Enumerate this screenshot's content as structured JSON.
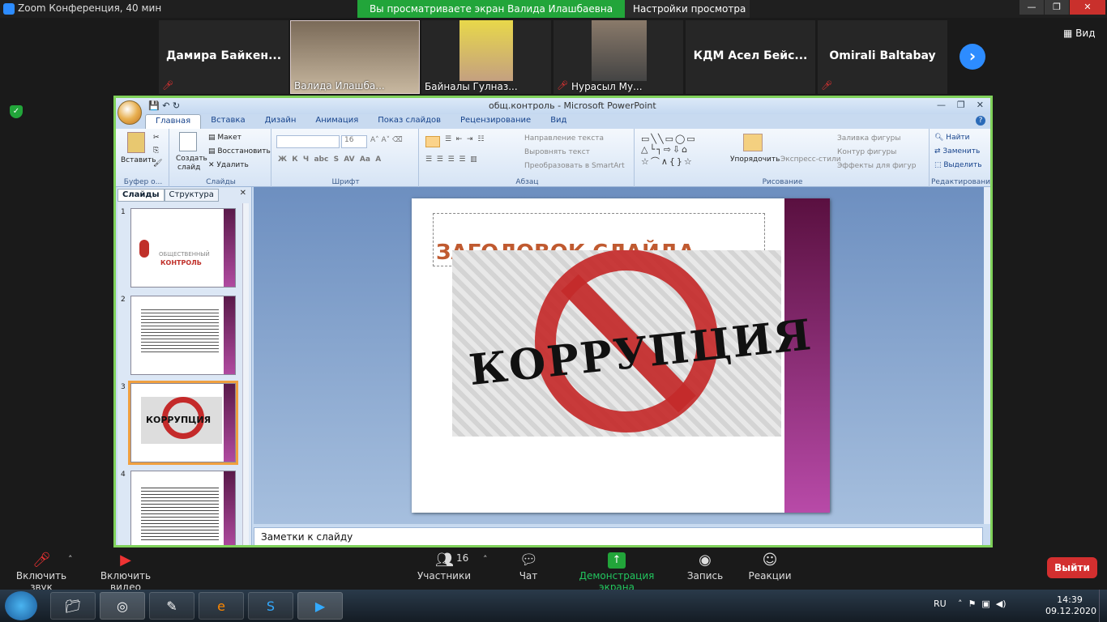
{
  "zoom": {
    "window_title": "Zoom Конференция, 40 мин",
    "share_banner": "Вы просматриваете экран Валида Илашбаевна",
    "view_options": "Настройки просмотра",
    "view_label": "Вид",
    "participants": [
      {
        "name": "Дамира  Байкен...",
        "muted": true,
        "video": false
      },
      {
        "name": "Валида Илашба...",
        "muted": false,
        "video": true
      },
      {
        "name": "Байналы Гулназ...",
        "muted": false,
        "video": true
      },
      {
        "name": "Нурасыл Му...",
        "muted": true,
        "video": true
      },
      {
        "name": "КДМ  Асел  Бейс...",
        "muted": false,
        "video": false
      },
      {
        "name": "Omirali Baltabay",
        "muted": true,
        "video": false
      }
    ],
    "toolbar": {
      "audio": "Включить звук",
      "video": "Включить видео",
      "participants": "Участники",
      "participants_count": "16",
      "chat": "Чат",
      "share": "Демонстрация экрана",
      "record": "Запись",
      "reactions": "Реакции",
      "leave": "Выйти"
    }
  },
  "ppt": {
    "title": "общ.контроль - Microsoft PowerPoint",
    "tabs": [
      "Главная",
      "Вставка",
      "Дизайн",
      "Анимация",
      "Показ слайдов",
      "Рецензирование",
      "Вид"
    ],
    "groups": {
      "clipboard": {
        "label": "Буфер о...",
        "paste": "Вставить"
      },
      "slides": {
        "label": "Слайды",
        "new_slide": "Создать",
        "new_slide2": "слайд",
        "layout": "Макет",
        "reset": "Восстановить",
        "delete": "Удалить"
      },
      "font": {
        "label": "Шрифт",
        "size": "16"
      },
      "paragraph": {
        "label": "Абзац",
        "text_dir": "Направление текста",
        "align": "Выровнять текст",
        "smartart": "Преобразовать в SmartArt"
      },
      "drawing": {
        "label": "Рисование",
        "arrange": "Упорядочить",
        "styles": "Экспресс-стили",
        "fill": "Заливка фигуры",
        "outline": "Контур фигуры",
        "effects": "Эффекты для фигур"
      },
      "editing": {
        "label": "Редактирование",
        "find": "Найти",
        "replace": "Заменить",
        "select": "Выделить"
      }
    },
    "panel_tabs": [
      "Слайды",
      "Структура"
    ],
    "slide_numbers": [
      "1",
      "2",
      "3",
      "4"
    ],
    "thumb1_text1": "ОБЩЕСТВЕННЫЙ",
    "thumb1_text2": "КОНТРОЛЬ",
    "slide_title": "ЗАГОЛОВОК СЛАЙДА",
    "slide_image_text": "КОРРУПЦИЯ",
    "notes": "Заметки к слайду"
  },
  "taskbar": {
    "lang": "RU",
    "time": "14:39",
    "date": "09.12.2020"
  }
}
